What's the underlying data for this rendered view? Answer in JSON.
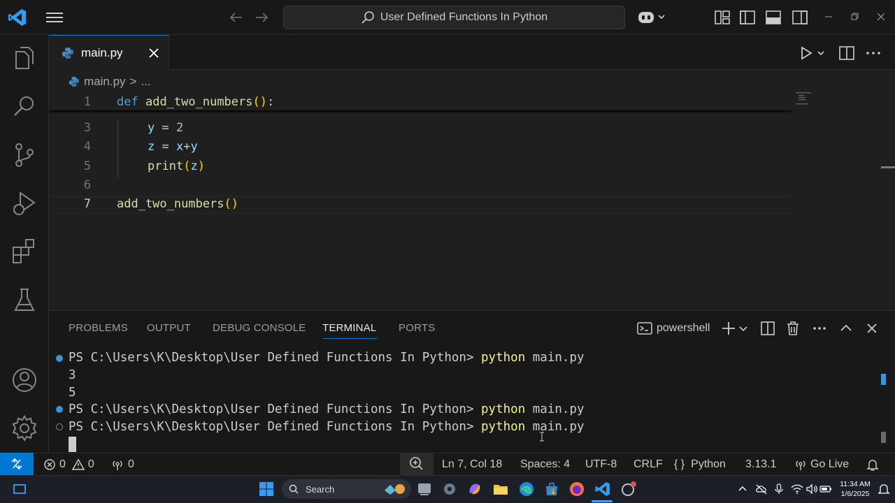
{
  "titlebar": {
    "search_text": "User Defined Functions In Python"
  },
  "tabs": [
    {
      "label": "main.py"
    }
  ],
  "breadcrumb": {
    "file": "main.py",
    "separator": ">",
    "rest": "..."
  },
  "editor": {
    "line_numbers": [
      "1",
      "3",
      "4",
      "5",
      "6",
      "7"
    ],
    "lines": {
      "l1": {
        "kw": "def",
        "name": "add_two_numbers",
        "paren": "()",
        "colon": ":"
      },
      "l3": {
        "var": "y",
        "op": " = ",
        "num": "2"
      },
      "l4": {
        "var1": "z",
        "op": " = ",
        "var2": "x",
        "plus": "+",
        "var3": "y"
      },
      "l5": {
        "fn": "print",
        "open": "(",
        "arg": "z",
        "close": ")"
      },
      "l7": {
        "name": "add_two_numbers",
        "paren": "()"
      }
    }
  },
  "panel": {
    "tabs": [
      "PROBLEMS",
      "OUTPUT",
      "DEBUG CONSOLE",
      "TERMINAL",
      "PORTS"
    ],
    "active_tab": "TERMINAL",
    "shell": "powershell",
    "terminal_lines": [
      {
        "prompt": "PS C:\\Users\\K\\Desktop\\User Defined Functions In Python> ",
        "cmd": "python",
        "args": " main.py"
      },
      {
        "text": "3"
      },
      {
        "text": "5"
      },
      {
        "prompt": "PS C:\\Users\\K\\Desktop\\User Defined Functions In Python> ",
        "cmd": "python",
        "args": " main.py"
      },
      {
        "prompt": "PS C:\\Users\\K\\Desktop\\User Defined Functions In Python> ",
        "cmd": "python",
        "args": " main.py"
      }
    ]
  },
  "statusbar": {
    "errors": "0",
    "warnings": "0",
    "ports": "0",
    "position": "Ln 7, Col 18",
    "spaces": "Spaces: 4",
    "encoding": "UTF-8",
    "eol": "CRLF",
    "language_icon": "{ }",
    "language": "Python",
    "version": "3.13.1",
    "golive": "Go Live"
  },
  "taskbar": {
    "search_label": "Search",
    "time": "11:34 AM",
    "date": "1/6/2025"
  },
  "colors": {
    "accent": "#0078d4",
    "keyword": "#569cd6",
    "function": "#dcdcaa",
    "variable": "#9cdcfe",
    "number": "#b5cea8",
    "bracket": "#ffd700",
    "command": "#f2f28c"
  }
}
